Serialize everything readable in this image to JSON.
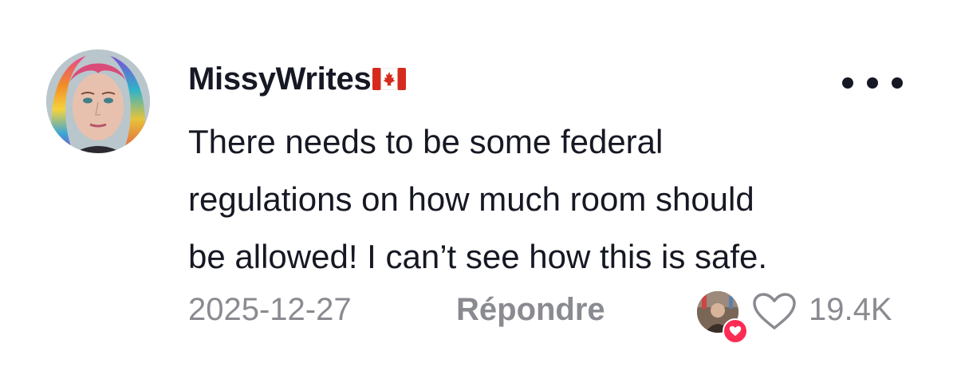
{
  "comment": {
    "username": "MissyWrites",
    "flag_icon": "canada-flag-icon",
    "text_lines": [
      "There needs to be some federal",
      "regulations on how much room should",
      "be allowed! I can’t see how this is safe."
    ],
    "date": "2025-12-27",
    "reply_label": "Répondre",
    "like_count": "19.4K"
  },
  "colors": {
    "primary_text": "#161823",
    "secondary_text": "#8a8b91",
    "heart_badge": "#fe2c55",
    "flag_red": "#d52b1e"
  },
  "icons": {
    "more": "more-options-icon",
    "like": "heart-outline-icon",
    "liked_badge": "heart-badge-icon"
  }
}
